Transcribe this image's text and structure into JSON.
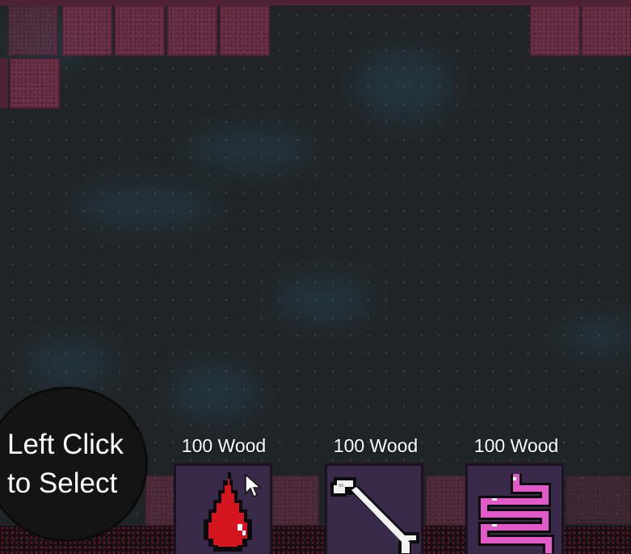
{
  "hint": {
    "line1": "Left Click",
    "line2": "to Select"
  },
  "build_menu": {
    "items": [
      {
        "cost": "100 Wood",
        "icon": "blood-drop-icon"
      },
      {
        "cost": "100 Wood",
        "icon": "bone-icon"
      },
      {
        "cost": "100 Wood",
        "icon": "intestine-icon"
      }
    ]
  },
  "colors": {
    "floor": "#202427",
    "flesh": "#6e2c44",
    "card_bg": "#3a2a4a",
    "blood": "#d4141e",
    "intestine": "#e25ac8"
  }
}
